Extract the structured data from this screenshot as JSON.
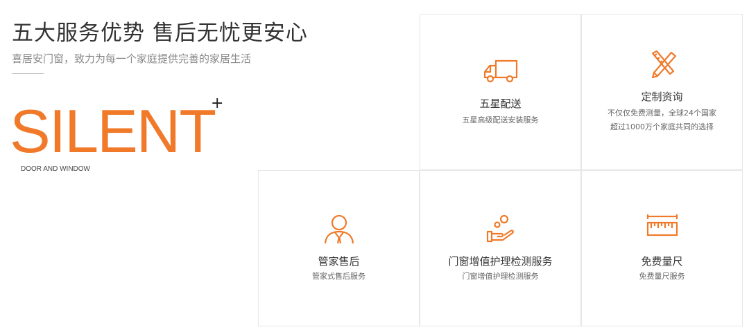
{
  "header": {
    "title": "五大服务优势 售后无忧更安心",
    "subtitle": "喜居安门窗，致力为每一个家庭提供完善的家居生活"
  },
  "brand": {
    "logo_text": "SILENT",
    "plus": "+",
    "tagline": "DOOR AND WINDOW",
    "accent_color": "#f07a2a"
  },
  "services": [
    {
      "icon": "delivery-truck-icon",
      "title": "五星配送",
      "desc_line1": "五星高级配送安装服务",
      "desc_line2": ""
    },
    {
      "icon": "ruler-pencil-icon",
      "title": "定制资询",
      "desc_line1": "不仅仅免费测量，全球24个国家",
      "desc_line2": "超过1000万个家庭共同的选择"
    },
    {
      "icon": "butler-icon",
      "title": "管家售后",
      "desc_line1": "管家式售后服务",
      "desc_line2": ""
    },
    {
      "icon": "care-hand-icon",
      "title": "门窗增值护理检测服务",
      "desc_line1": "门窗增值护理检测服务",
      "desc_line2": ""
    },
    {
      "icon": "measure-ruler-icon",
      "title": "免费量尺",
      "desc_line1": "免费量尺服务",
      "desc_line2": ""
    }
  ]
}
